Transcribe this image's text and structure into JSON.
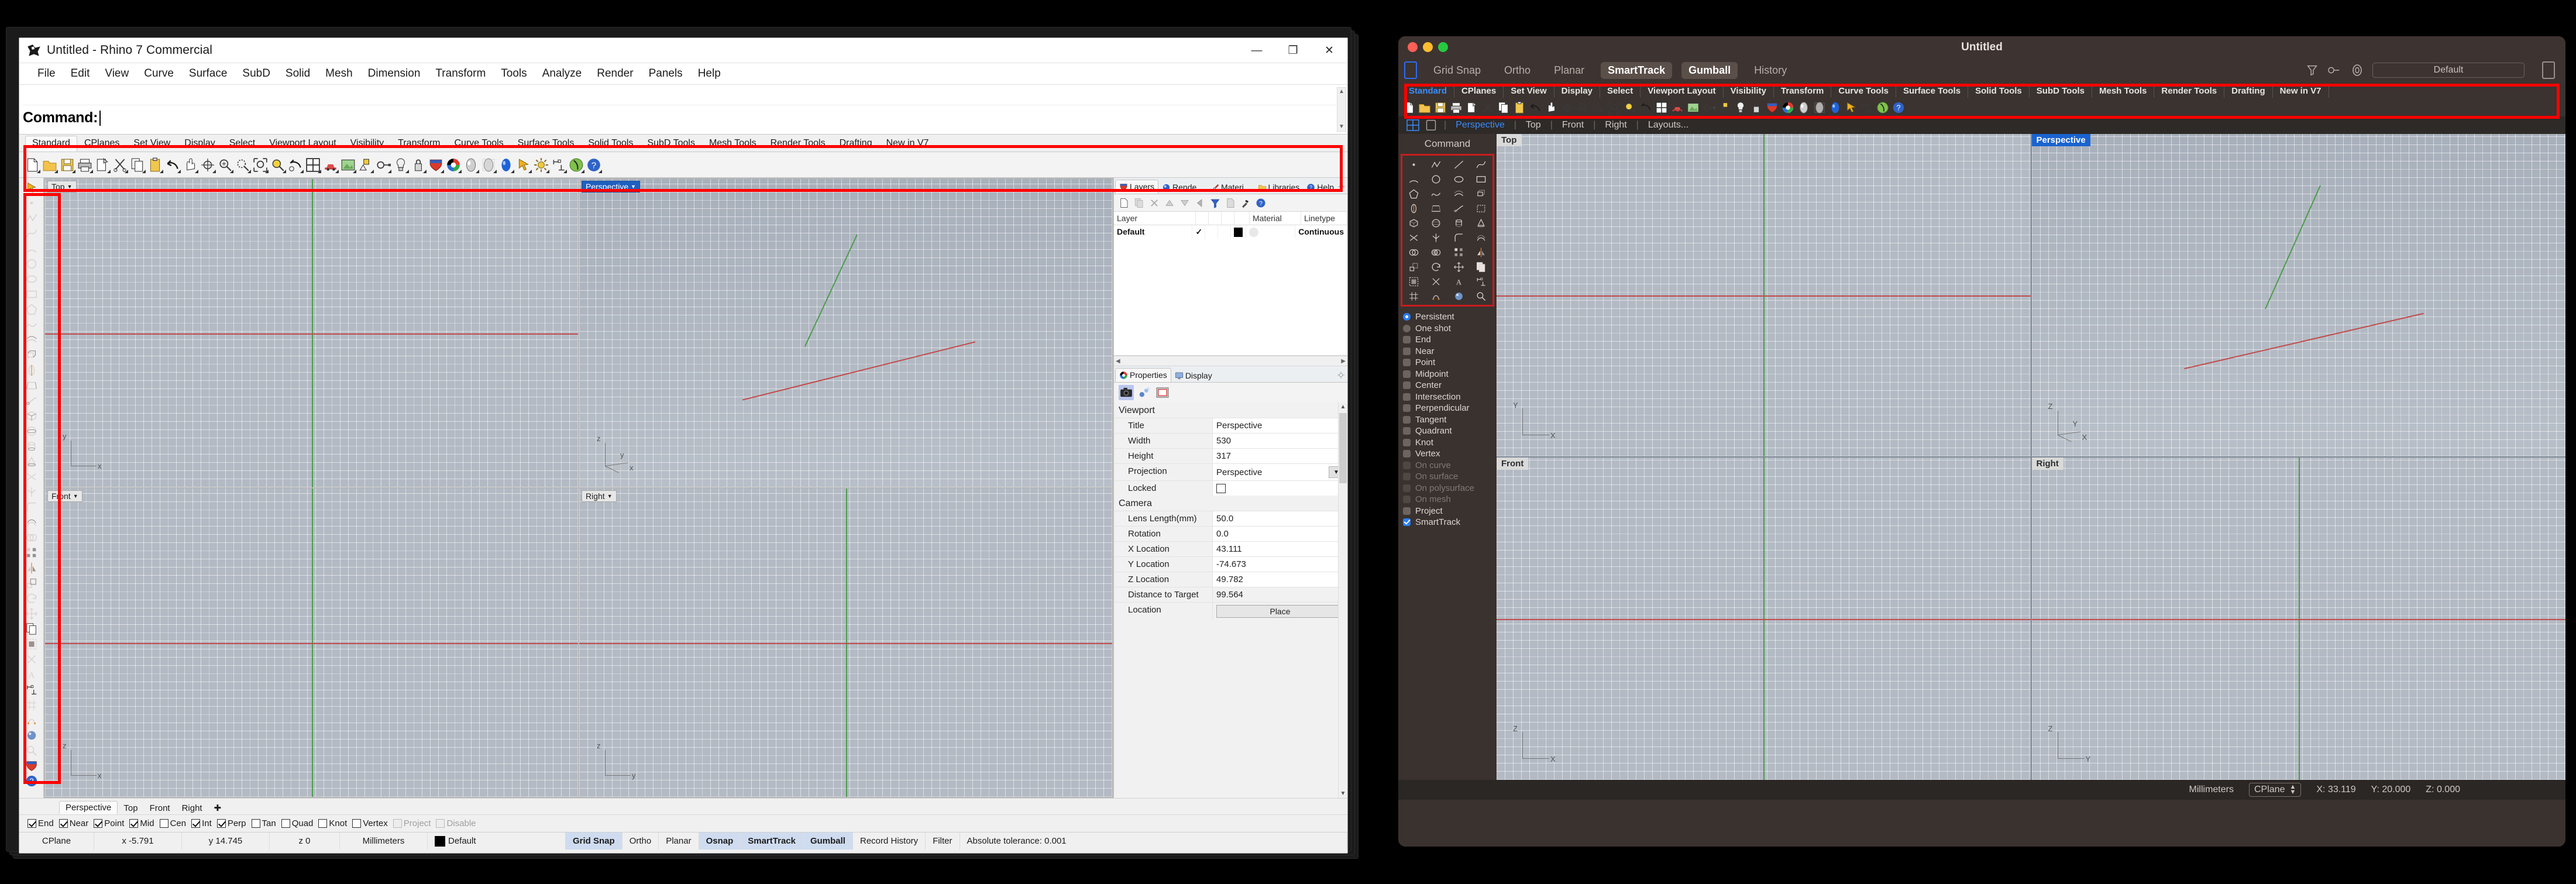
{
  "windows": {
    "title": "Untitled - Rhino 7 Commercial",
    "app_icon": "rhino-icon",
    "window_controls": {
      "minimize": "—",
      "maximize": "❐",
      "close": "✕"
    },
    "menu": [
      "File",
      "Edit",
      "View",
      "Curve",
      "Surface",
      "SubD",
      "Solid",
      "Mesh",
      "Dimension",
      "Transform",
      "Tools",
      "Analyze",
      "Render",
      "Panels",
      "Help"
    ],
    "command": {
      "label": "Command:",
      "value": ""
    },
    "toolbar_tabs": [
      "Standard",
      "CPlanes",
      "Set View",
      "Display",
      "Select",
      "Viewport Layout",
      "Visibility",
      "Transform",
      "Curve Tools",
      "Surface Tools",
      "Solid Tools",
      "SubD Tools",
      "Mesh Tools",
      "Render Tools",
      "Drafting",
      "New in V7"
    ],
    "toolbar_active_tab": "Standard",
    "toolbar_icons": [
      "new-file-icon",
      "open-folder-icon",
      "save-icon",
      "print-icon",
      "copy-to-clipboard-icon",
      "cut-scissors-icon",
      "copy-icon",
      "paste-icon",
      "undo-arrow-icon",
      "pan-hand-icon",
      "rotate-view-icon",
      "zoom-in-out-icon",
      "zoom-dynamic-icon",
      "zoom-window-icon",
      "zoom-selected-icon",
      "zoom-previous-icon",
      "viewport-layout-icon",
      "car-render-icon",
      "render-preview-icon",
      "point-light-icon",
      "named-views-icon",
      "light-bulb-icon",
      "lock-icon",
      "layers-shield-icon",
      "color-wheel-icon",
      "shade-icon",
      "ghosted-icon",
      "render-blue-icon",
      "select-arrow-icon",
      "options-gear-icon",
      "dimension-icon",
      "rhino-help-globe-icon",
      "help-question-icon"
    ],
    "panels": {
      "tabs": [
        {
          "label": "Layers",
          "icon": "layers-shield-icon",
          "active": true
        },
        {
          "label": "Rende...",
          "icon": "render-sphere-icon",
          "active": false
        },
        {
          "label": "Materi...",
          "icon": "material-brush-icon",
          "active": false
        },
        {
          "label": "Libraries",
          "icon": "folder-icon",
          "active": false
        },
        {
          "label": "Help",
          "icon": "help-icon",
          "active": false
        }
      ],
      "gear_icon": "gear-icon",
      "layer_toolbar_icons": [
        "new-layer-icon",
        "copy-layer-icon",
        "delete-layer-icon",
        "move-up-icon",
        "move-down-icon",
        "back-arrow-icon",
        "filter-icon",
        "layer-sheet-icon",
        "layer-tools-hammer-icon",
        "help-icon"
      ],
      "layer_columns": [
        "Layer",
        "",
        "",
        "",
        "",
        "Material",
        "Linetype"
      ],
      "layer_rows": [
        {
          "name": "Default",
          "on": "✓",
          "color": "#000000",
          "material": "",
          "linetype": "Continuous"
        }
      ]
    },
    "properties": {
      "tabs": [
        {
          "label": "Properties",
          "icon": "color-wheel-icon",
          "active": true
        },
        {
          "label": "Display",
          "icon": "monitor-icon",
          "active": false
        }
      ],
      "icons": [
        "camera-icon",
        "light-icon",
        "viewport-frame-icon"
      ],
      "sections": [
        {
          "title": "Viewport",
          "rows": [
            {
              "key": "Title",
              "value": "Perspective",
              "type": "text"
            },
            {
              "key": "Width",
              "value": "530",
              "type": "text"
            },
            {
              "key": "Height",
              "value": "317",
              "type": "text"
            },
            {
              "key": "Projection",
              "value": "Perspective",
              "type": "dropdown"
            },
            {
              "key": "Locked",
              "value": "",
              "type": "checkbox"
            }
          ]
        },
        {
          "title": "Camera",
          "rows": [
            {
              "key": "Lens Length(mm)",
              "value": "50.0",
              "type": "text"
            },
            {
              "key": "Rotation",
              "value": "0.0",
              "type": "text"
            },
            {
              "key": "X Location",
              "value": "43.111",
              "type": "text"
            },
            {
              "key": "Y Location",
              "value": "-74.673",
              "type": "text"
            },
            {
              "key": "Z Location",
              "value": "49.782",
              "type": "text"
            },
            {
              "key": "Distance to Target",
              "value": "99.564",
              "type": "plain"
            },
            {
              "key": "Location",
              "value": "Place",
              "type": "button"
            }
          ]
        }
      ]
    },
    "viewports": [
      {
        "label": "Top",
        "active": false
      },
      {
        "label": "Perspective",
        "active": true
      },
      {
        "label": "Front",
        "active": false
      },
      {
        "label": "Right",
        "active": false
      }
    ],
    "viewport_tabs": [
      "Perspective",
      "Top",
      "Front",
      "Right"
    ],
    "viewport_tab_active": "Perspective",
    "viewport_tab_add": "+",
    "osnaps": [
      {
        "label": "End",
        "checked": true,
        "disabled": false
      },
      {
        "label": "Near",
        "checked": true,
        "disabled": false
      },
      {
        "label": "Point",
        "checked": true,
        "disabled": false
      },
      {
        "label": "Mid",
        "checked": true,
        "disabled": false
      },
      {
        "label": "Cen",
        "checked": false,
        "disabled": false
      },
      {
        "label": "Int",
        "checked": true,
        "disabled": false
      },
      {
        "label": "Perp",
        "checked": true,
        "disabled": false
      },
      {
        "label": "Tan",
        "checked": false,
        "disabled": false
      },
      {
        "label": "Quad",
        "checked": false,
        "disabled": false
      },
      {
        "label": "Knot",
        "checked": false,
        "disabled": false
      },
      {
        "label": "Vertex",
        "checked": false,
        "disabled": false
      },
      {
        "label": "Project",
        "checked": false,
        "disabled": true
      },
      {
        "label": "Disable",
        "checked": false,
        "disabled": true
      }
    ],
    "statusbar": {
      "cplane": "CPlane",
      "x": "x -5.791",
      "y": "y 14.745",
      "z": "z 0",
      "units": "Millimeters",
      "layer": "Default",
      "layer_color": "#000000",
      "toggles": [
        {
          "label": "Grid Snap",
          "on": true
        },
        {
          "label": "Ortho",
          "on": false
        },
        {
          "label": "Planar",
          "on": false
        },
        {
          "label": "Osnap",
          "on": true
        },
        {
          "label": "SmartTrack",
          "on": true
        },
        {
          "label": "Gumball",
          "on": true
        },
        {
          "label": "Record History",
          "on": false
        },
        {
          "label": "Filter",
          "on": false
        }
      ],
      "tolerance": "Absolute tolerance: 0.001"
    }
  },
  "mac": {
    "title": "Untitled",
    "traffic_lights": [
      "#ff5f57",
      "#febc2e",
      "#28c840"
    ],
    "sidebar_left_icon": "left-sidebar-toggle-icon",
    "sidebar_right_icon": "right-sidebar-toggle-icon",
    "toggles": [
      {
        "label": "Grid Snap",
        "on": false
      },
      {
        "label": "Ortho",
        "on": false
      },
      {
        "label": "Planar",
        "on": false
      },
      {
        "label": "SmartTrack",
        "on": true
      },
      {
        "label": "Gumball",
        "on": true
      },
      {
        "label": "History",
        "on": false
      }
    ],
    "right_icons": [
      "filter-icon",
      "linetype-icon",
      "print-width-icon"
    ],
    "layer_selector": "Default",
    "toolbar_tabs": [
      "Standard",
      "CPlanes",
      "Set View",
      "Display",
      "Select",
      "Viewport Layout",
      "Visibility",
      "Transform",
      "Curve Tools",
      "Surface Tools",
      "Solid Tools",
      "SubD Tools",
      "Mesh Tools",
      "Render Tools",
      "Drafting",
      "New in V7"
    ],
    "toolbar_active_tab": "Standard",
    "toolbar_icons": [
      "new-file-icon",
      "open-folder-icon",
      "save-icon",
      "print-icon",
      "copy-to-clipboard-icon",
      "cut-scissors-icon",
      "copy-icon",
      "paste-icon",
      "undo-arrow-icon",
      "pan-hand-icon",
      "rotate-view-icon",
      "zoom-in-out-icon",
      "zoom-dynamic-icon",
      "zoom-window-icon",
      "zoom-selected-icon",
      "zoom-previous-icon",
      "viewport-layout-icon",
      "car-render-icon",
      "render-preview-icon",
      "named-views-icon",
      "point-light-icon",
      "light-bulb-icon",
      "lock-icon",
      "layers-shield-icon",
      "color-wheel-icon",
      "shade-icon",
      "ghosted-icon",
      "render-blue-icon",
      "select-arrow-icon",
      "dimension-icon",
      "rhino-help-globe-icon",
      "help-question-icon"
    ],
    "viewport_bar": {
      "layout_icon": "four-view-layout-icon",
      "single_icon": "single-view-icon",
      "links": [
        "Perspective",
        "Top",
        "Front",
        "Right",
        "Layouts..."
      ],
      "active": "Perspective"
    },
    "command_label": "Command",
    "palette_icons": [
      "point-icon",
      "polyline-icon",
      "line-icon",
      "curve-icon",
      "arc-icon",
      "circle-icon",
      "ellipse-icon",
      "rectangle-icon",
      "polygon-icon",
      "freeform-curve-icon",
      "surface-from-curves-icon",
      "extrude-icon",
      "revolve-icon",
      "loft-icon",
      "sweep-icon",
      "patch-icon",
      "box-icon",
      "sphere-icon",
      "cylinder-icon",
      "cone-icon",
      "trim-icon",
      "split-icon",
      "fillet-icon",
      "offset-icon",
      "boolean-union-icon",
      "boolean-difference-icon",
      "array-icon",
      "mirror-icon",
      "scale-icon",
      "rotate-icon",
      "move-icon",
      "copy-icon",
      "group-icon",
      "explode-icon",
      "text-icon",
      "dimension-icon",
      "mesh-icon",
      "subd-icon",
      "render-icon",
      "analyze-icon"
    ],
    "osnaps": [
      {
        "label": "Persistent",
        "type": "radio",
        "on": true,
        "disabled": false
      },
      {
        "label": "One shot",
        "type": "radio",
        "on": false,
        "disabled": false
      },
      {
        "label": "End",
        "type": "check",
        "on": false,
        "disabled": false
      },
      {
        "label": "Near",
        "type": "check",
        "on": false,
        "disabled": false
      },
      {
        "label": "Point",
        "type": "check",
        "on": false,
        "disabled": false
      },
      {
        "label": "Midpoint",
        "type": "check",
        "on": false,
        "disabled": false
      },
      {
        "label": "Center",
        "type": "check",
        "on": false,
        "disabled": false
      },
      {
        "label": "Intersection",
        "type": "check",
        "on": false,
        "disabled": false
      },
      {
        "label": "Perpendicular",
        "type": "check",
        "on": false,
        "disabled": false
      },
      {
        "label": "Tangent",
        "type": "check",
        "on": false,
        "disabled": false
      },
      {
        "label": "Quadrant",
        "type": "check",
        "on": false,
        "disabled": false
      },
      {
        "label": "Knot",
        "type": "check",
        "on": false,
        "disabled": false
      },
      {
        "label": "Vertex",
        "type": "check",
        "on": false,
        "disabled": false
      },
      {
        "label": "On curve",
        "type": "check",
        "on": false,
        "disabled": true
      },
      {
        "label": "On surface",
        "type": "check",
        "on": false,
        "disabled": true
      },
      {
        "label": "On polysurface",
        "type": "check",
        "on": false,
        "disabled": true
      },
      {
        "label": "On mesh",
        "type": "check",
        "on": false,
        "disabled": true
      },
      {
        "label": "Project",
        "type": "check",
        "on": false,
        "disabled": false
      },
      {
        "label": "SmartTrack",
        "type": "check",
        "on": true,
        "disabled": false
      }
    ],
    "viewports": [
      {
        "label": "Top",
        "active": false
      },
      {
        "label": "Perspective",
        "active": true
      },
      {
        "label": "Front",
        "active": false
      },
      {
        "label": "Right",
        "active": false
      }
    ],
    "statusbar": {
      "units": "Millimeters",
      "cplane": "CPlane",
      "x": "X: 33.119",
      "y": "Y: 20.000",
      "z": "Z: 0.000"
    }
  },
  "annotations": {
    "highlight_color": "#fe0000",
    "boxes": [
      "windows-toolbar-highlight",
      "windows-vertical-toolbar-highlight",
      "mac-toolbar-highlight",
      "mac-palette-highlight"
    ]
  }
}
